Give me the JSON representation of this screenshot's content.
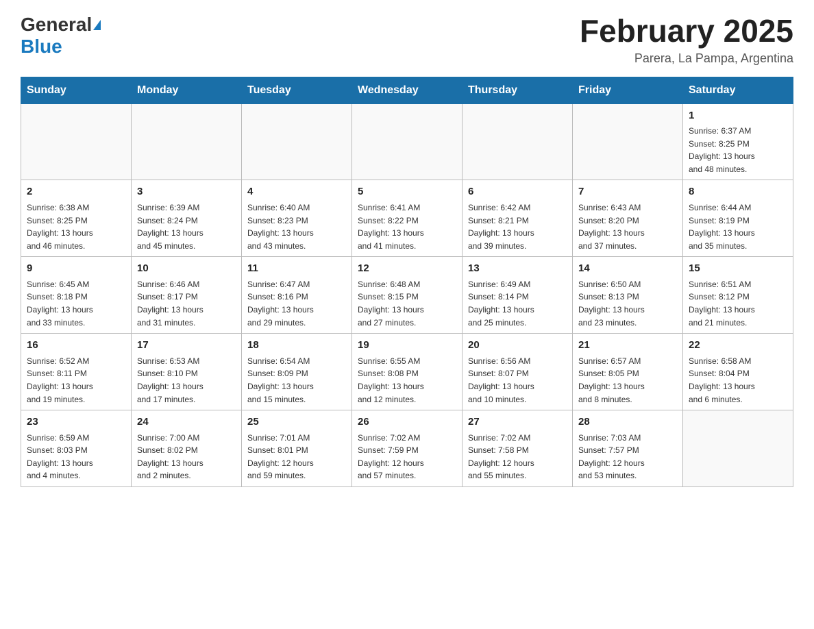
{
  "header": {
    "logo_general": "General",
    "logo_blue": "Blue",
    "title": "February 2025",
    "location": "Parera, La Pampa, Argentina"
  },
  "days_of_week": [
    "Sunday",
    "Monday",
    "Tuesday",
    "Wednesday",
    "Thursday",
    "Friday",
    "Saturday"
  ],
  "weeks": [
    [
      {
        "day": "",
        "info": ""
      },
      {
        "day": "",
        "info": ""
      },
      {
        "day": "",
        "info": ""
      },
      {
        "day": "",
        "info": ""
      },
      {
        "day": "",
        "info": ""
      },
      {
        "day": "",
        "info": ""
      },
      {
        "day": "1",
        "info": "Sunrise: 6:37 AM\nSunset: 8:25 PM\nDaylight: 13 hours\nand 48 minutes."
      }
    ],
    [
      {
        "day": "2",
        "info": "Sunrise: 6:38 AM\nSunset: 8:25 PM\nDaylight: 13 hours\nand 46 minutes."
      },
      {
        "day": "3",
        "info": "Sunrise: 6:39 AM\nSunset: 8:24 PM\nDaylight: 13 hours\nand 45 minutes."
      },
      {
        "day": "4",
        "info": "Sunrise: 6:40 AM\nSunset: 8:23 PM\nDaylight: 13 hours\nand 43 minutes."
      },
      {
        "day": "5",
        "info": "Sunrise: 6:41 AM\nSunset: 8:22 PM\nDaylight: 13 hours\nand 41 minutes."
      },
      {
        "day": "6",
        "info": "Sunrise: 6:42 AM\nSunset: 8:21 PM\nDaylight: 13 hours\nand 39 minutes."
      },
      {
        "day": "7",
        "info": "Sunrise: 6:43 AM\nSunset: 8:20 PM\nDaylight: 13 hours\nand 37 minutes."
      },
      {
        "day": "8",
        "info": "Sunrise: 6:44 AM\nSunset: 8:19 PM\nDaylight: 13 hours\nand 35 minutes."
      }
    ],
    [
      {
        "day": "9",
        "info": "Sunrise: 6:45 AM\nSunset: 8:18 PM\nDaylight: 13 hours\nand 33 minutes."
      },
      {
        "day": "10",
        "info": "Sunrise: 6:46 AM\nSunset: 8:17 PM\nDaylight: 13 hours\nand 31 minutes."
      },
      {
        "day": "11",
        "info": "Sunrise: 6:47 AM\nSunset: 8:16 PM\nDaylight: 13 hours\nand 29 minutes."
      },
      {
        "day": "12",
        "info": "Sunrise: 6:48 AM\nSunset: 8:15 PM\nDaylight: 13 hours\nand 27 minutes."
      },
      {
        "day": "13",
        "info": "Sunrise: 6:49 AM\nSunset: 8:14 PM\nDaylight: 13 hours\nand 25 minutes."
      },
      {
        "day": "14",
        "info": "Sunrise: 6:50 AM\nSunset: 8:13 PM\nDaylight: 13 hours\nand 23 minutes."
      },
      {
        "day": "15",
        "info": "Sunrise: 6:51 AM\nSunset: 8:12 PM\nDaylight: 13 hours\nand 21 minutes."
      }
    ],
    [
      {
        "day": "16",
        "info": "Sunrise: 6:52 AM\nSunset: 8:11 PM\nDaylight: 13 hours\nand 19 minutes."
      },
      {
        "day": "17",
        "info": "Sunrise: 6:53 AM\nSunset: 8:10 PM\nDaylight: 13 hours\nand 17 minutes."
      },
      {
        "day": "18",
        "info": "Sunrise: 6:54 AM\nSunset: 8:09 PM\nDaylight: 13 hours\nand 15 minutes."
      },
      {
        "day": "19",
        "info": "Sunrise: 6:55 AM\nSunset: 8:08 PM\nDaylight: 13 hours\nand 12 minutes."
      },
      {
        "day": "20",
        "info": "Sunrise: 6:56 AM\nSunset: 8:07 PM\nDaylight: 13 hours\nand 10 minutes."
      },
      {
        "day": "21",
        "info": "Sunrise: 6:57 AM\nSunset: 8:05 PM\nDaylight: 13 hours\nand 8 minutes."
      },
      {
        "day": "22",
        "info": "Sunrise: 6:58 AM\nSunset: 8:04 PM\nDaylight: 13 hours\nand 6 minutes."
      }
    ],
    [
      {
        "day": "23",
        "info": "Sunrise: 6:59 AM\nSunset: 8:03 PM\nDaylight: 13 hours\nand 4 minutes."
      },
      {
        "day": "24",
        "info": "Sunrise: 7:00 AM\nSunset: 8:02 PM\nDaylight: 13 hours\nand 2 minutes."
      },
      {
        "day": "25",
        "info": "Sunrise: 7:01 AM\nSunset: 8:01 PM\nDaylight: 12 hours\nand 59 minutes."
      },
      {
        "day": "26",
        "info": "Sunrise: 7:02 AM\nSunset: 7:59 PM\nDaylight: 12 hours\nand 57 minutes."
      },
      {
        "day": "27",
        "info": "Sunrise: 7:02 AM\nSunset: 7:58 PM\nDaylight: 12 hours\nand 55 minutes."
      },
      {
        "day": "28",
        "info": "Sunrise: 7:03 AM\nSunset: 7:57 PM\nDaylight: 12 hours\nand 53 minutes."
      },
      {
        "day": "",
        "info": ""
      }
    ]
  ]
}
